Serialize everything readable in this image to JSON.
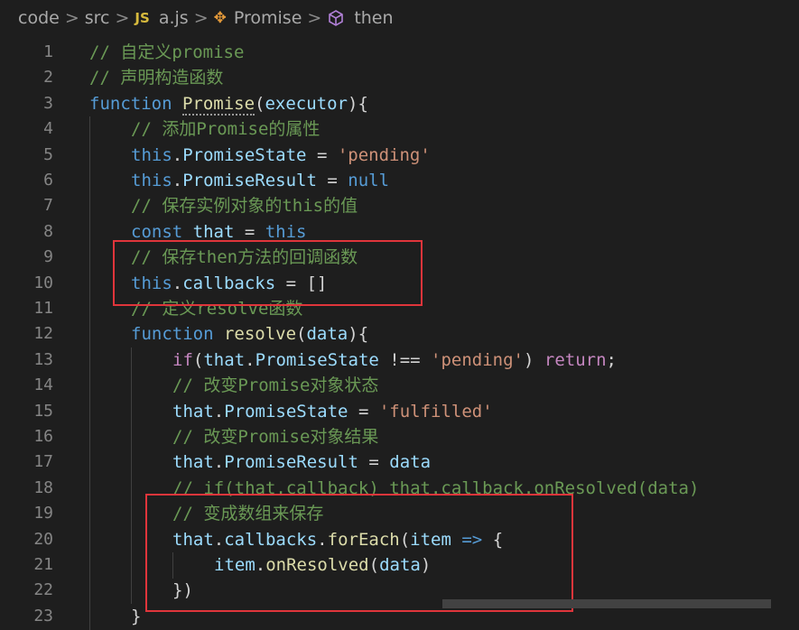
{
  "breadcrumb": {
    "items": [
      "code",
      "src",
      "a.js",
      "Promise",
      "then"
    ],
    "separator": ">",
    "js_badge": "JS"
  },
  "colors": {
    "background": "#1e1e1e",
    "comment": "#6a9955",
    "keyword": "#569cd6",
    "function": "#dcdcaa",
    "string": "#ce9178",
    "property": "#9cdcfe",
    "control": "#c586c0",
    "highlight_box": "#e0353b"
  },
  "lines": [
    {
      "n": "1",
      "indent": 0,
      "tokens": [
        [
          "cm",
          "// 自定义promise"
        ]
      ]
    },
    {
      "n": "2",
      "indent": 0,
      "tokens": [
        [
          "cm",
          "// 声明构造函数"
        ]
      ]
    },
    {
      "n": "3",
      "indent": 0,
      "tokens": [
        [
          "kw",
          "function "
        ],
        [
          "fnu",
          "Promise"
        ],
        [
          "pl",
          "("
        ],
        [
          "prop",
          "executor"
        ],
        [
          "pl",
          "){"
        ]
      ]
    },
    {
      "n": "4",
      "indent": 1,
      "tokens": [
        [
          "cm",
          "// 添加Promise的属性"
        ]
      ]
    },
    {
      "n": "5",
      "indent": 1,
      "tokens": [
        [
          "kw",
          "this"
        ],
        [
          "pl",
          "."
        ],
        [
          "prop",
          "PromiseState"
        ],
        [
          "pl",
          " = "
        ],
        [
          "str",
          "'pending'"
        ]
      ]
    },
    {
      "n": "6",
      "indent": 1,
      "tokens": [
        [
          "kw",
          "this"
        ],
        [
          "pl",
          "."
        ],
        [
          "prop",
          "PromiseResult"
        ],
        [
          "pl",
          " = "
        ],
        [
          "kw",
          "null"
        ]
      ]
    },
    {
      "n": "7",
      "indent": 1,
      "tokens": [
        [
          "cm",
          "// 保存实例对象的this的值"
        ]
      ]
    },
    {
      "n": "8",
      "indent": 1,
      "tokens": [
        [
          "kw",
          "const "
        ],
        [
          "prop",
          "that"
        ],
        [
          "pl",
          " = "
        ],
        [
          "kw",
          "this"
        ]
      ]
    },
    {
      "n": "9",
      "indent": 1,
      "tokens": [
        [
          "cm",
          "// 保存then方法的回调函数"
        ]
      ]
    },
    {
      "n": "10",
      "indent": 1,
      "tokens": [
        [
          "kw",
          "this"
        ],
        [
          "pl",
          "."
        ],
        [
          "prop",
          "callbacks"
        ],
        [
          "pl",
          " = []"
        ]
      ]
    },
    {
      "n": "11",
      "indent": 1,
      "tokens": [
        [
          "cm",
          "// 定义resolve函数"
        ]
      ]
    },
    {
      "n": "12",
      "indent": 1,
      "tokens": [
        [
          "kw",
          "function "
        ],
        [
          "fn",
          "resolve"
        ],
        [
          "pl",
          "("
        ],
        [
          "prop",
          "data"
        ],
        [
          "pl",
          "){"
        ]
      ]
    },
    {
      "n": "13",
      "indent": 2,
      "tokens": [
        [
          "ctl",
          "if"
        ],
        [
          "pl",
          "("
        ],
        [
          "prop",
          "that"
        ],
        [
          "pl",
          "."
        ],
        [
          "prop",
          "PromiseState"
        ],
        [
          "pl",
          " !== "
        ],
        [
          "str",
          "'pending'"
        ],
        [
          "pl",
          ") "
        ],
        [
          "ctl",
          "return"
        ],
        [
          "pl",
          ";"
        ]
      ]
    },
    {
      "n": "14",
      "indent": 2,
      "tokens": [
        [
          "cm",
          "// 改变Promise对象状态"
        ]
      ]
    },
    {
      "n": "15",
      "indent": 2,
      "tokens": [
        [
          "prop",
          "that"
        ],
        [
          "pl",
          "."
        ],
        [
          "prop",
          "PromiseState"
        ],
        [
          "pl",
          " = "
        ],
        [
          "str",
          "'fulfilled'"
        ]
      ]
    },
    {
      "n": "16",
      "indent": 2,
      "tokens": [
        [
          "cm",
          "// 改变Promise对象结果"
        ]
      ]
    },
    {
      "n": "17",
      "indent": 2,
      "tokens": [
        [
          "prop",
          "that"
        ],
        [
          "pl",
          "."
        ],
        [
          "prop",
          "PromiseResult"
        ],
        [
          "pl",
          " = "
        ],
        [
          "prop",
          "data"
        ]
      ]
    },
    {
      "n": "18",
      "indent": 2,
      "tokens": [
        [
          "cm",
          "// if(that.callback) that.callback.onResolved(data)"
        ]
      ]
    },
    {
      "n": "19",
      "indent": 2,
      "tokens": [
        [
          "cm",
          "// 变成数组来保存"
        ]
      ]
    },
    {
      "n": "20",
      "indent": 2,
      "tokens": [
        [
          "prop",
          "that"
        ],
        [
          "pl",
          "."
        ],
        [
          "prop",
          "callbacks"
        ],
        [
          "pl",
          "."
        ],
        [
          "fn",
          "forEach"
        ],
        [
          "pl",
          "("
        ],
        [
          "prop",
          "item"
        ],
        [
          "kw",
          " => "
        ],
        [
          "pl",
          "{"
        ]
      ]
    },
    {
      "n": "21",
      "indent": 3,
      "tokens": [
        [
          "prop",
          "item"
        ],
        [
          "pl",
          "."
        ],
        [
          "fn",
          "onResolved"
        ],
        [
          "pl",
          "("
        ],
        [
          "prop",
          "data"
        ],
        [
          "pl",
          ")"
        ]
      ]
    },
    {
      "n": "22",
      "indent": 2,
      "tokens": [
        [
          "pl",
          "})"
        ]
      ]
    },
    {
      "n": "23",
      "indent": 1,
      "tokens": [
        [
          "pl",
          "}"
        ]
      ]
    }
  ]
}
